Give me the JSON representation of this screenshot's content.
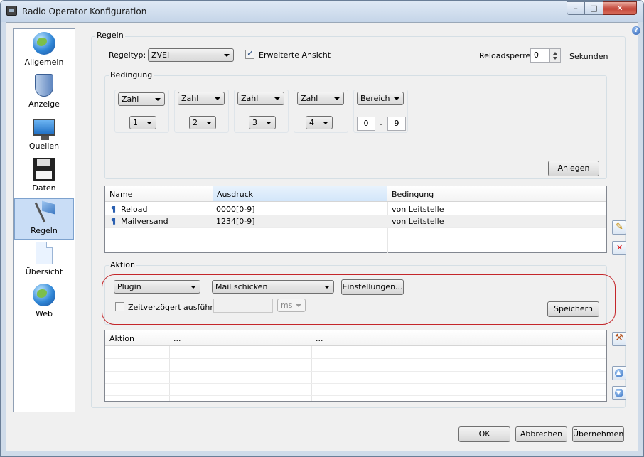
{
  "window": {
    "title": "Radio Operator Konfiguration",
    "minimize": "–",
    "maximize": "□",
    "close": "✕"
  },
  "help": "?",
  "sidebar": {
    "items": [
      {
        "label": "Allgemein",
        "icon": "globe-icon"
      },
      {
        "label": "Anzeige",
        "icon": "shield-icon"
      },
      {
        "label": "Quellen",
        "icon": "monitor-icon"
      },
      {
        "label": "Daten",
        "icon": "floppy-disk-icon"
      },
      {
        "label": "Regeln",
        "icon": "flag-icon",
        "selected": true
      },
      {
        "label": "Übersicht",
        "icon": "document-icon"
      },
      {
        "label": "Web",
        "icon": "web-globe-icon"
      }
    ]
  },
  "regeln": {
    "legend": "Regeln",
    "regeltyp_label": "Regeltyp:",
    "regeltyp_value": "ZVEI",
    "erweitert_label": "Erweiterte Ansicht",
    "erweitert_checked": true,
    "reloadsperre_label": "Reloadsperre:",
    "reloadsperre_value": "0",
    "sekunden_label": "Sekunden"
  },
  "bedingung": {
    "legend": "Bedingung",
    "boxes": [
      {
        "type": "Zahl",
        "value": "1"
      },
      {
        "type": "Zahl",
        "value": "2"
      },
      {
        "type": "Zahl",
        "value": "3"
      },
      {
        "type": "Zahl",
        "value": "4"
      }
    ],
    "bereich": {
      "type": "Bereich",
      "from": "0",
      "sep": "-",
      "to": "9"
    },
    "anlegen": "Anlegen"
  },
  "rules_table": {
    "columns": [
      "Name",
      "Ausdruck",
      "Bedingung"
    ],
    "rows": [
      {
        "name": "Reload",
        "ausdruck": "0000[0-9]",
        "bedingung": "von Leitstelle"
      },
      {
        "name": "Mailversand",
        "ausdruck": "1234[0-9]",
        "bedingung": "von Leitstelle"
      }
    ]
  },
  "aktion": {
    "legend": "Aktion",
    "type_value": "Plugin",
    "plugin_value": "Mail schicken",
    "einstellungen": "Einstellungen...",
    "zeit_label": "Zeitverzögert ausführen",
    "zeit_value": "",
    "unit_value": "ms",
    "speichern": "Speichern"
  },
  "actions_table": {
    "columns": [
      "Aktion",
      "...",
      "..."
    ]
  },
  "footer": {
    "ok": "OK",
    "abbrechen": "Abbrechen",
    "uebernehmen": "Übernehmen"
  }
}
